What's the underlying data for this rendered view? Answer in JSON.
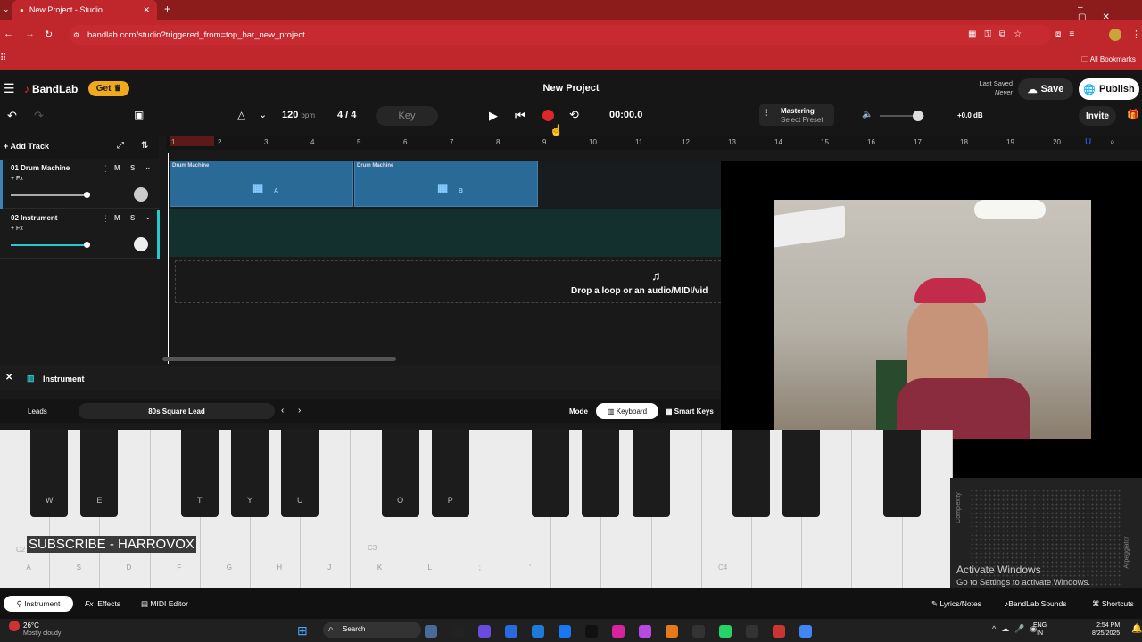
{
  "browser": {
    "tab_title": "New Project - Studio",
    "new_tab": "+",
    "url": "bandlab.com/studio?triggered_from=top_bar_new_project",
    "bookmarks": "All Bookmarks"
  },
  "app": {
    "logo": "BandLab",
    "get_label": "Get",
    "project_title": "New Project",
    "last_saved_label": "Last Saved",
    "last_saved_value": "Never",
    "save_label": "Save",
    "publish_label": "Publish",
    "invite_label": "Invite"
  },
  "transport": {
    "bpm": "120",
    "bpm_unit": "bpm",
    "time_signature": "4 / 4",
    "key_label": "Key",
    "time": "00:00.0",
    "mastering_label": "Mastering",
    "mastering_preset": "Select Preset",
    "volume_db": "+0.0 dB"
  },
  "tracks": {
    "add_track": "Add Track",
    "items": [
      {
        "name": "01  Drum Machine",
        "fx": "+ Fx",
        "m": "M",
        "s": "S"
      },
      {
        "name": "02  Instrument",
        "fx": "+ Fx",
        "m": "M",
        "s": "S"
      }
    ]
  },
  "ruler": [
    "1",
    "2",
    "3",
    "4",
    "5",
    "6",
    "7",
    "8",
    "9",
    "10",
    "11",
    "12",
    "13",
    "14",
    "15",
    "16",
    "17",
    "18",
    "19",
    "20"
  ],
  "clips": [
    {
      "title": "Drum Machine",
      "letter": "A"
    },
    {
      "title": "Drum Machine",
      "letter": "B"
    }
  ],
  "drop_text": "Drop a loop or an audio/MIDI/vid",
  "instrument_panel": {
    "title": "Instrument",
    "category": "Leads",
    "preset": "80s Square Lead",
    "mode_label": "Mode",
    "keyboard_label": "Keyboard",
    "smart_keys_label": "Smart Keys"
  },
  "keyboard": {
    "black_keys": [
      "W",
      "E",
      "T",
      "Y",
      "U",
      "O",
      "P"
    ],
    "white_keys": [
      "A",
      "S",
      "D",
      "F",
      "G",
      "H",
      "J",
      "K",
      "L",
      ";",
      "'"
    ],
    "octave_c3": "C3",
    "octave_c4": "C4",
    "octave_c2": "C2"
  },
  "overlay": {
    "subscribe": "SUBSCRIBE - HARROVOX",
    "activate_title": "Activate Windows",
    "activate_sub": "Go to Settings to activate Windows."
  },
  "side_labels": {
    "complexity": "Complexity",
    "arpeggiator": "Arpeggiator"
  },
  "bottom_tabs": {
    "instrument": "Instrument",
    "effects": "Effects",
    "midi_editor": "MIDI Editor",
    "lyrics": "Lyrics/Notes",
    "sounds": "BandLab Sounds",
    "shortcuts": "Shortcuts"
  },
  "taskbar": {
    "temp": "26°C",
    "weather": "Mostly cloudy",
    "search": "Search",
    "lang1": "ENG",
    "lang2": "IN",
    "time": "2:54 PM",
    "date": "8/25/2025"
  },
  "colors": {
    "browser_red": "#c0272d",
    "record": "#e0262a",
    "clip_blue": "#2a6a96",
    "accent_get": "#f0a81e"
  }
}
